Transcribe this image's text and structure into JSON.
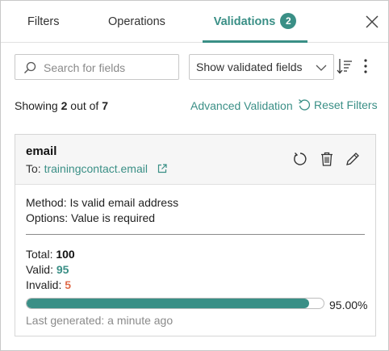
{
  "tabs": {
    "filters": "Filters",
    "operations": "Operations",
    "validations": "Validations",
    "validations_count": "2"
  },
  "toolbar": {
    "search_placeholder": "Search for fields",
    "search_value": "",
    "view_select": "Show validated fields",
    "sort_icon": "sort-icon",
    "more_icon": "more-vertical-icon"
  },
  "summary": {
    "showing_prefix": "Showing",
    "shown": "2",
    "out_of": "out of",
    "total": "7",
    "advanced_validation": "Advanced Validation",
    "reset_filters": "Reset Filters"
  },
  "card": {
    "field_name": "email",
    "to_label": "To:",
    "to_target": "trainingcontact.email",
    "method": "Method: Is valid email address",
    "options": "Options: Value is required",
    "total_label": "Total:",
    "total_value": "100",
    "valid_label": "Valid:",
    "valid_value": "95",
    "invalid_label": "Invalid:",
    "invalid_value": "5",
    "progress_fraction": 0.95,
    "progress_text": "95.00%",
    "last_generated": "Last generated: a minute ago"
  },
  "colors": {
    "accent": "#3a8f86",
    "invalid": "#e06b4a"
  }
}
